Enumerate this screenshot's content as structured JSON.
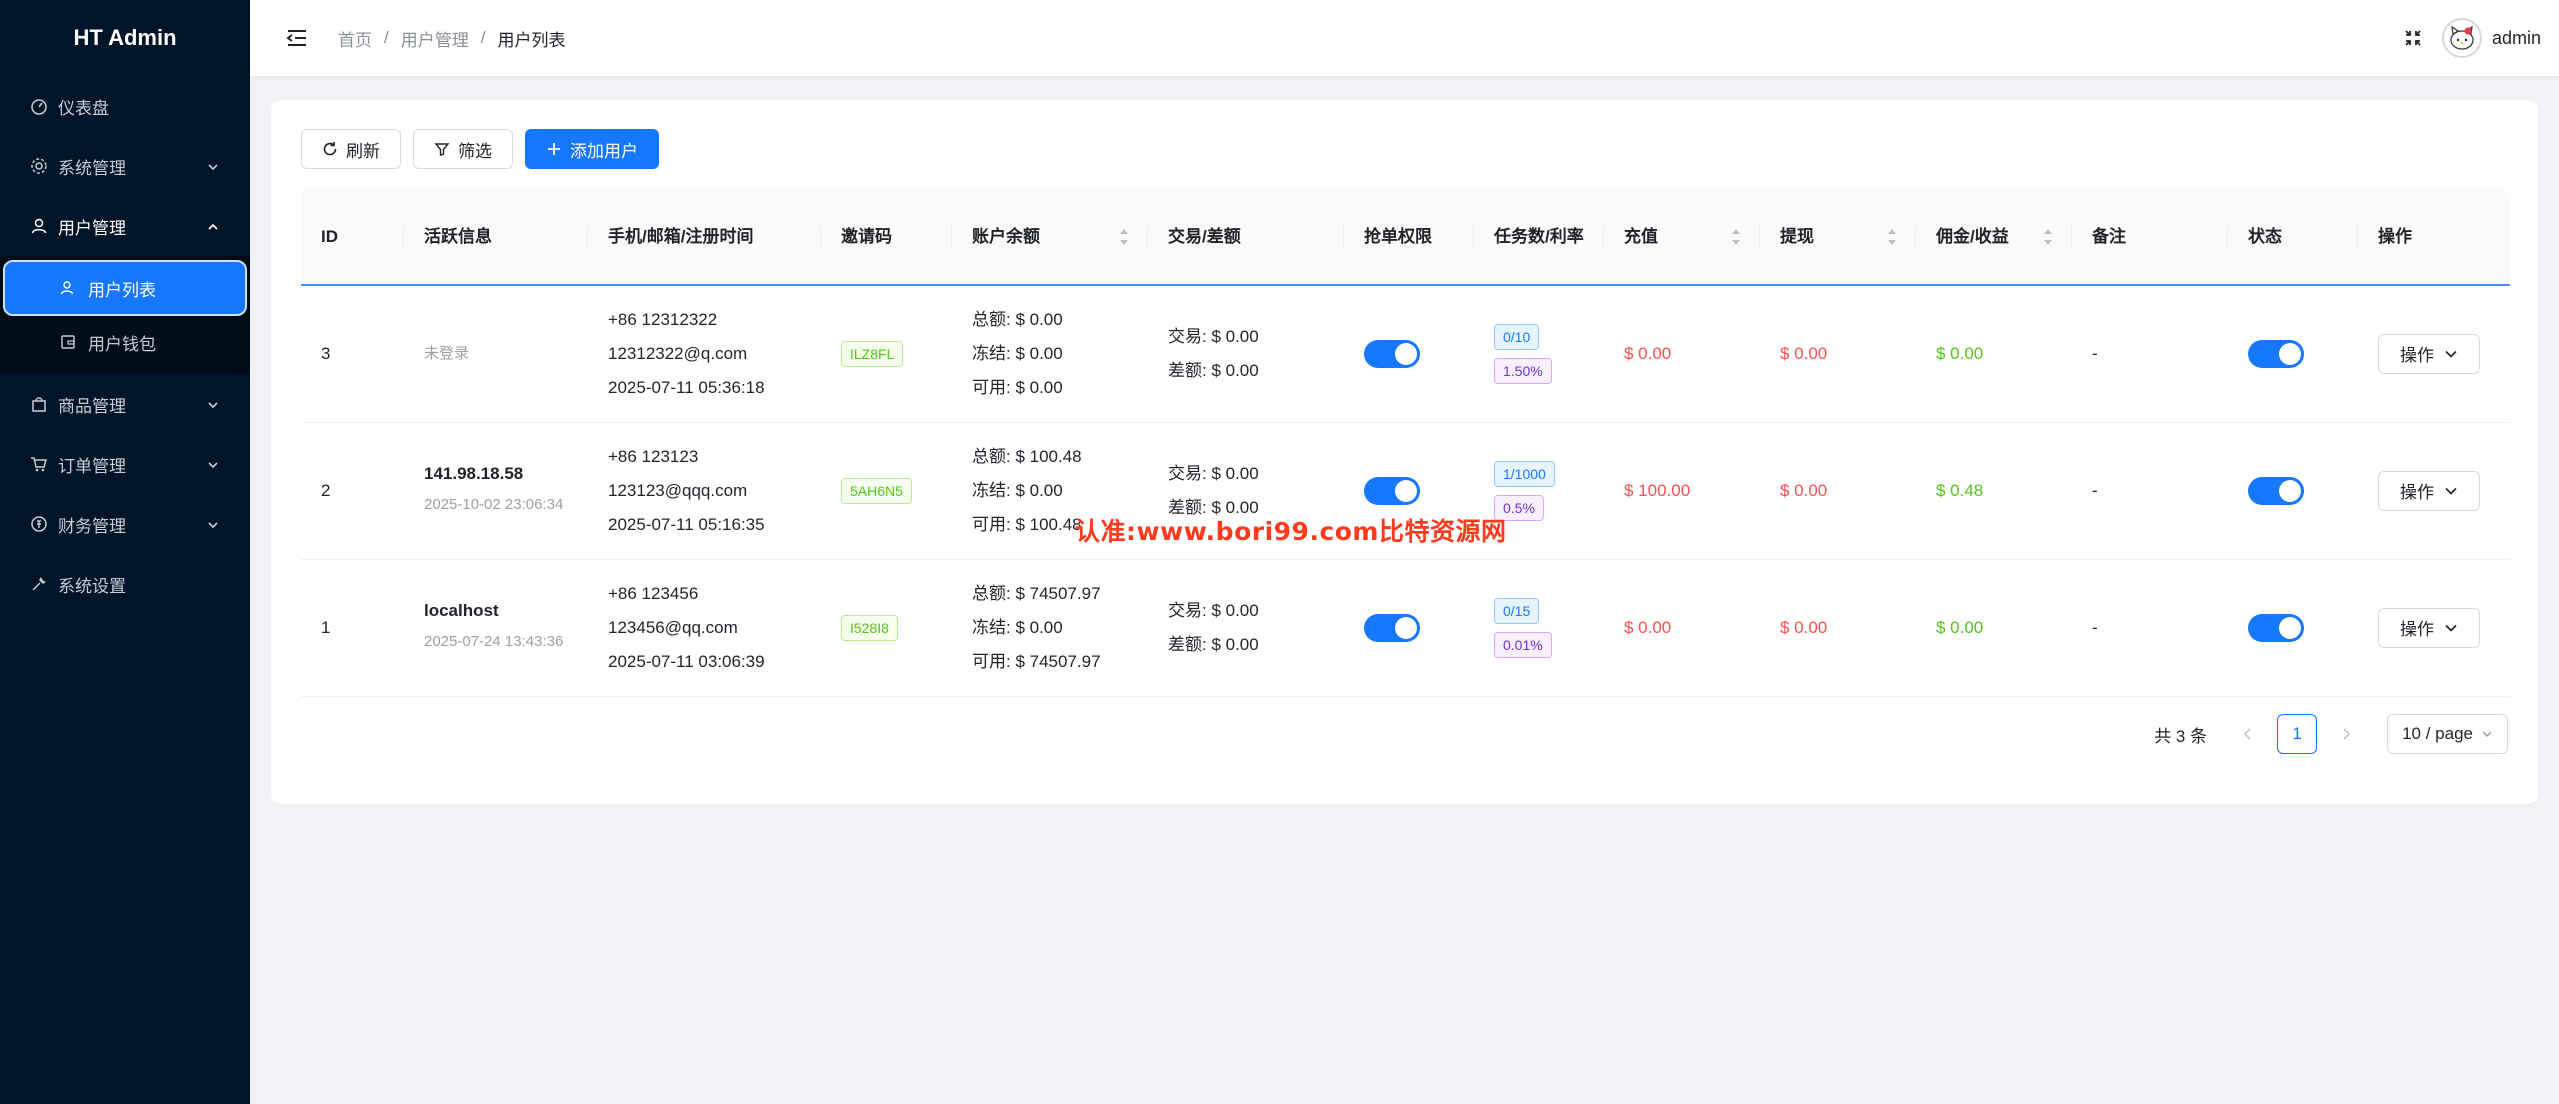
{
  "app": {
    "title": "HT Admin"
  },
  "sidebar": {
    "items": [
      {
        "label": "仪表盘",
        "icon": "dashboard-icon"
      },
      {
        "label": "系统管理",
        "icon": "gear-icon"
      },
      {
        "label": "用户管理",
        "icon": "user-icon"
      },
      {
        "label": "商品管理",
        "icon": "shopping-bag-icon"
      },
      {
        "label": "订单管理",
        "icon": "cart-icon"
      },
      {
        "label": "财务管理",
        "icon": "finance-icon"
      },
      {
        "label": "系统设置",
        "icon": "wrench-icon"
      }
    ],
    "user_sub": [
      {
        "label": "用户列表",
        "icon": "users-icon",
        "active": true
      },
      {
        "label": "用户钱包",
        "icon": "wallet-icon"
      }
    ]
  },
  "header": {
    "breadcrumb": [
      "首页",
      "用户管理",
      "用户列表"
    ],
    "username": "admin"
  },
  "toolbar": {
    "refresh_label": "刷新",
    "filter_label": "筛选",
    "add_label": "添加用户"
  },
  "table": {
    "columns": [
      "ID",
      "活跃信息",
      "手机/邮箱/注册时间",
      "邀请码",
      "账户余额",
      "交易/差额",
      "抢单权限",
      "任务数/利率",
      "充值",
      "提现",
      "佣金/收益",
      "备注",
      "状态",
      "操作"
    ],
    "rows": [
      {
        "id": "3",
        "active_main": "",
        "active_sub": "未登录",
        "phone": "+86 12312322",
        "email": "12312322@q.com",
        "reg_time": "2025-07-11 05:36:18",
        "invite": "ILZ8FL",
        "bal_total": "总额: $ 0.00",
        "bal_frozen": "冻结: $ 0.00",
        "bal_avail": "可用: $ 0.00",
        "trade": "交易: $ 0.00",
        "diff": "差额: $ 0.00",
        "grab_enabled": true,
        "tasks": "0/10",
        "rate": "1.50%",
        "recharge": "$ 0.00",
        "withdraw": "$ 0.00",
        "commission": "$ 0.00",
        "remark": "-",
        "status_enabled": true,
        "op_label": "操作"
      },
      {
        "id": "2",
        "active_main": "141.98.18.58",
        "active_sub": "2025-10-02 23:06:34",
        "phone": "+86 123123",
        "email": "123123@qqq.com",
        "reg_time": "2025-07-11 05:16:35",
        "invite": "5AH6N5",
        "bal_total": "总额: $ 100.48",
        "bal_frozen": "冻结: $ 0.00",
        "bal_avail": "可用: $ 100.48",
        "trade": "交易: $ 0.00",
        "diff": "差额: $ 0.00",
        "grab_enabled": true,
        "tasks": "1/1000",
        "rate": "0.5%",
        "recharge": "$ 100.00",
        "withdraw": "$ 0.00",
        "commission": "$ 0.48",
        "remark": "-",
        "status_enabled": true,
        "op_label": "操作"
      },
      {
        "id": "1",
        "active_main": "localhost",
        "active_sub": "2025-07-24 13:43:36",
        "phone": "+86 123456",
        "email": "123456@qq.com",
        "reg_time": "2025-07-11 03:06:39",
        "invite": "I528I8",
        "bal_total": "总额: $ 74507.97",
        "bal_frozen": "冻结: $ 0.00",
        "bal_avail": "可用: $ 74507.97",
        "trade": "交易: $ 0.00",
        "diff": "差额: $ 0.00",
        "grab_enabled": true,
        "tasks": "0/15",
        "rate": "0.01%",
        "recharge": "$ 0.00",
        "withdraw": "$ 0.00",
        "commission": "$ 0.00",
        "remark": "-",
        "status_enabled": true,
        "op_label": "操作"
      }
    ]
  },
  "pagination": {
    "total": "共 3 条",
    "page": "1",
    "page_size": "10 / page"
  },
  "watermark": "认准:www.bori99.com比特资源网",
  "colors": {
    "sidebar_bg": "#001529",
    "accent": "#1677ff",
    "red": "#ff4d4f",
    "green": "#52c41a"
  }
}
